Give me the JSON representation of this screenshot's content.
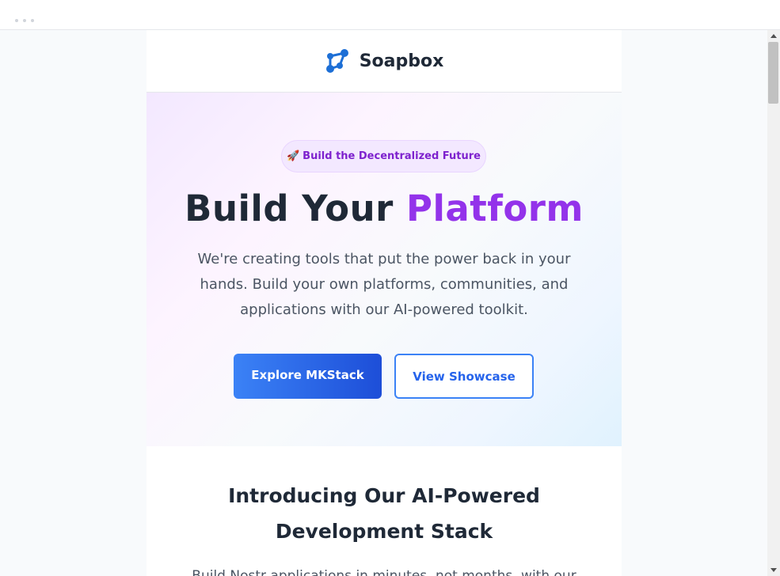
{
  "brand": {
    "name": "Soapbox",
    "logo_icon": "network-nodes-icon",
    "accent_color": "#1d6fd6"
  },
  "hero": {
    "badge_icon": "🚀",
    "badge_text": "Build the Decentralized Future",
    "title_main": "Build Your ",
    "title_accent": "Platform",
    "description": "We're creating tools that put the power back in your hands. Build your own platforms, communities, and applications with our AI-powered toolkit.",
    "primary_button": "Explore MKStack",
    "secondary_button": "View Showcase"
  },
  "intro": {
    "title": "Introducing Our AI-Powered Development Stack",
    "text": "Build Nostr applications in minutes, not months, with our"
  }
}
